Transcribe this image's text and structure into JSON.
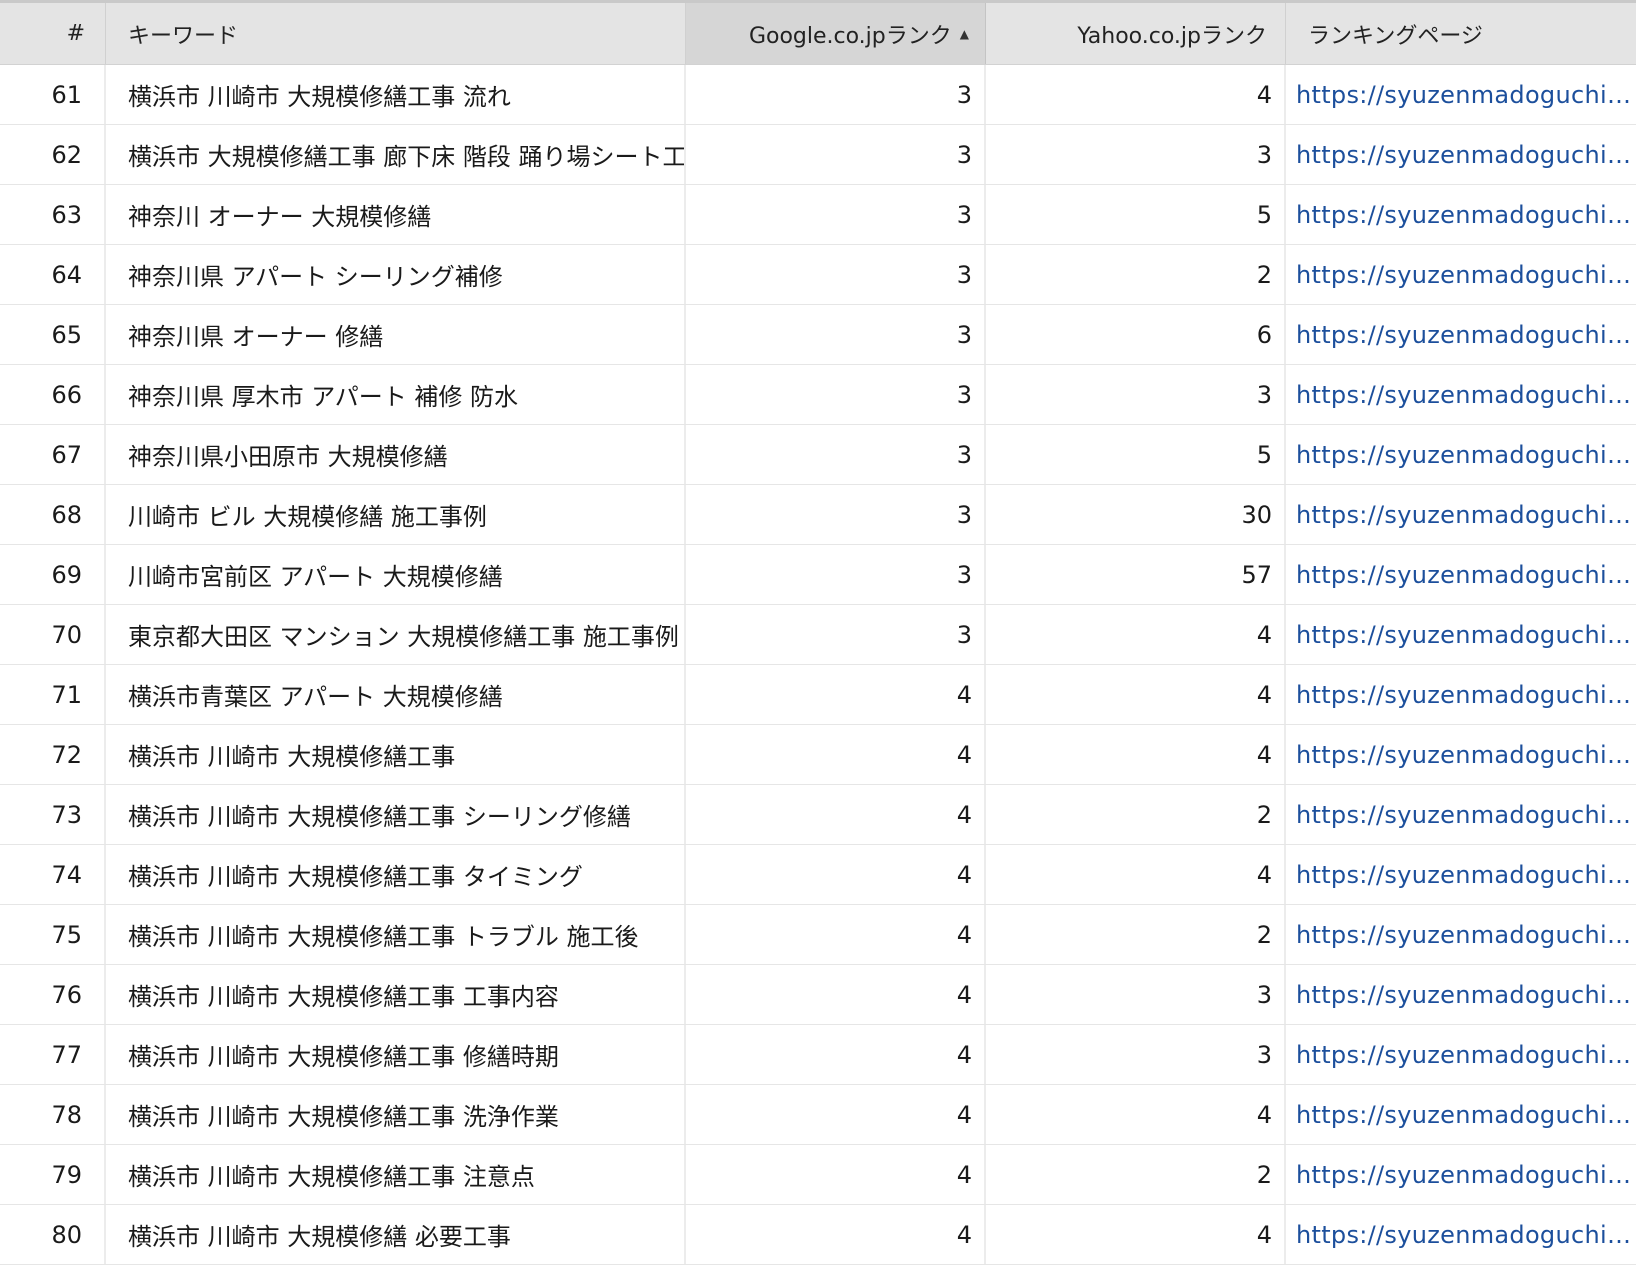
{
  "table": {
    "columns": {
      "num": "#",
      "keyword": "キーワード",
      "google": "Google.co.jpランク",
      "yahoo": "Yahoo.co.jpランク",
      "url": "ランキングページ"
    },
    "sort": {
      "column": "google",
      "direction": "ascending",
      "indicator": "▲"
    },
    "rows": [
      {
        "num": "61",
        "keyword": "横浜市 川崎市 大規模修繕工事 流れ",
        "google": "3",
        "yahoo": "4",
        "url": "https://syuzenmadoguchi...."
      },
      {
        "num": "62",
        "keyword": "横浜市 大規模修繕工事 廊下床 階段 踊り場シート工",
        "google": "3",
        "yahoo": "3",
        "url": "https://syuzenmadoguchi...."
      },
      {
        "num": "63",
        "keyword": "神奈川 オーナー 大規模修繕",
        "google": "3",
        "yahoo": "5",
        "url": "https://syuzenmadoguchi...."
      },
      {
        "num": "64",
        "keyword": "神奈川県 アパート シーリング補修",
        "google": "3",
        "yahoo": "2",
        "url": "https://syuzenmadoguchi...."
      },
      {
        "num": "65",
        "keyword": "神奈川県 オーナー 修繕",
        "google": "3",
        "yahoo": "6",
        "url": "https://syuzenmadoguchi...."
      },
      {
        "num": "66",
        "keyword": "神奈川県 厚木市 アパート 補修 防水",
        "google": "3",
        "yahoo": "3",
        "url": "https://syuzenmadoguchi...."
      },
      {
        "num": "67",
        "keyword": "神奈川県小田原市 大規模修繕",
        "google": "3",
        "yahoo": "5",
        "url": "https://syuzenmadoguchi...."
      },
      {
        "num": "68",
        "keyword": "川崎市 ビル 大規模修繕 施工事例",
        "google": "3",
        "yahoo": "30",
        "url": "https://syuzenmadoguchi...."
      },
      {
        "num": "69",
        "keyword": "川崎市宮前区 アパート 大規模修繕",
        "google": "3",
        "yahoo": "57",
        "url": "https://syuzenmadoguchi...."
      },
      {
        "num": "70",
        "keyword": "東京都大田区 マンション 大規模修繕工事 施工事例",
        "google": "3",
        "yahoo": "4",
        "url": "https://syuzenmadoguchi...."
      },
      {
        "num": "71",
        "keyword": "横浜市青葉区 アパート 大規模修繕",
        "google": "4",
        "yahoo": "4",
        "url": "https://syuzenmadoguchi...."
      },
      {
        "num": "72",
        "keyword": "横浜市 川崎市 大規模修繕工事",
        "google": "4",
        "yahoo": "4",
        "url": "https://syuzenmadoguchi...."
      },
      {
        "num": "73",
        "keyword": "横浜市 川崎市 大規模修繕工事 シーリング修繕",
        "google": "4",
        "yahoo": "2",
        "url": "https://syuzenmadoguchi...."
      },
      {
        "num": "74",
        "keyword": "横浜市 川崎市 大規模修繕工事 タイミング",
        "google": "4",
        "yahoo": "4",
        "url": "https://syuzenmadoguchi...."
      },
      {
        "num": "75",
        "keyword": "横浜市 川崎市 大規模修繕工事 トラブル 施工後",
        "google": "4",
        "yahoo": "2",
        "url": "https://syuzenmadoguchi...."
      },
      {
        "num": "76",
        "keyword": "横浜市 川崎市 大規模修繕工事 工事内容",
        "google": "4",
        "yahoo": "3",
        "url": "https://syuzenmadoguchi...."
      },
      {
        "num": "77",
        "keyword": "横浜市 川崎市 大規模修繕工事 修繕時期",
        "google": "4",
        "yahoo": "3",
        "url": "https://syuzenmadoguchi...."
      },
      {
        "num": "78",
        "keyword": "横浜市 川崎市 大規模修繕工事 洗浄作業",
        "google": "4",
        "yahoo": "4",
        "url": "https://syuzenmadoguchi...."
      },
      {
        "num": "79",
        "keyword": "横浜市 川崎市 大規模修繕工事 注意点",
        "google": "4",
        "yahoo": "2",
        "url": "https://syuzenmadoguchi...."
      },
      {
        "num": "80",
        "keyword": "横浜市 川崎市 大規模修繕 必要工事",
        "google": "4",
        "yahoo": "4",
        "url": "https://syuzenmadoguchi...."
      }
    ]
  },
  "colors": {
    "link": "#1c4f9c",
    "header_bg": "#e4e4e4",
    "sorted_header_bg": "#d6d6d6"
  }
}
